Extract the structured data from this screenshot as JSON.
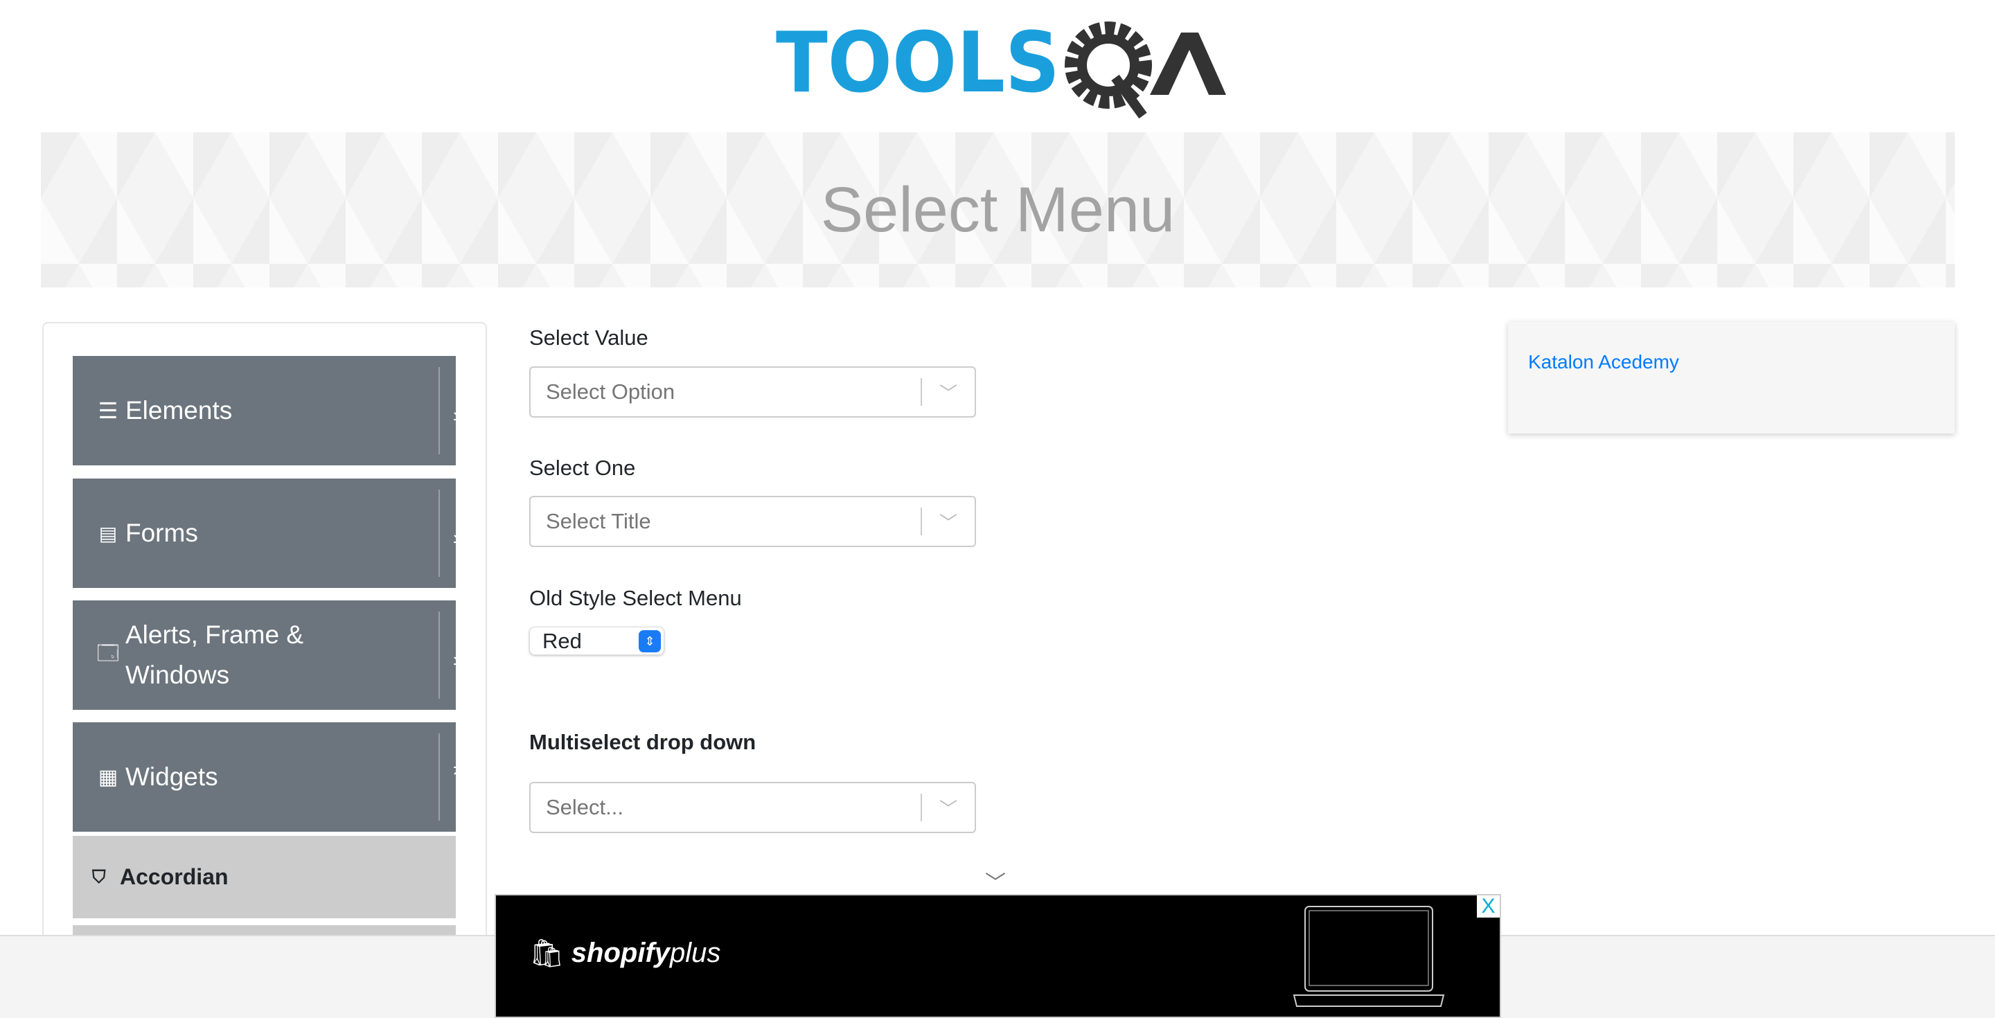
{
  "logo": {
    "text_left": "TOOLS",
    "text_right": "QA",
    "colors": {
      "blue": "#1a9fdc",
      "dark": "#333333"
    }
  },
  "banner": {
    "title": "Select Menu"
  },
  "sidebar": {
    "groups": [
      {
        "label": "Elements",
        "icon": "menu-icon",
        "arrow": "download-arrow-icon"
      },
      {
        "label": "Forms",
        "icon": "document-icon",
        "arrow": "download-arrow-icon"
      },
      {
        "label": "Alerts, Frame & Windows",
        "icon": "window-icon",
        "arrow": "download-arrow-icon"
      },
      {
        "label": "Widgets",
        "icon": "widgets-icon",
        "arrow": "upload-arrow-icon"
      }
    ],
    "active_item": {
      "label": "Accordian",
      "icon": "html5-icon"
    }
  },
  "form": {
    "select_value": {
      "label": "Select Value",
      "placeholder": "Select Option"
    },
    "select_one": {
      "label": "Select One",
      "placeholder": "Select Title"
    },
    "old_style": {
      "label": "Old Style Select Menu",
      "value": "Red"
    },
    "multiselect": {
      "label": "Multiselect drop down",
      "placeholder": "Select..."
    }
  },
  "katalon": {
    "link": "Katalon Acedemy"
  },
  "ad": {
    "brand": "shopify",
    "brand_suffix": "plus",
    "close": "X"
  },
  "colors": {
    "sidebar_group": "#6c757d",
    "active_item": "#cccccc",
    "link": "#007bff"
  }
}
